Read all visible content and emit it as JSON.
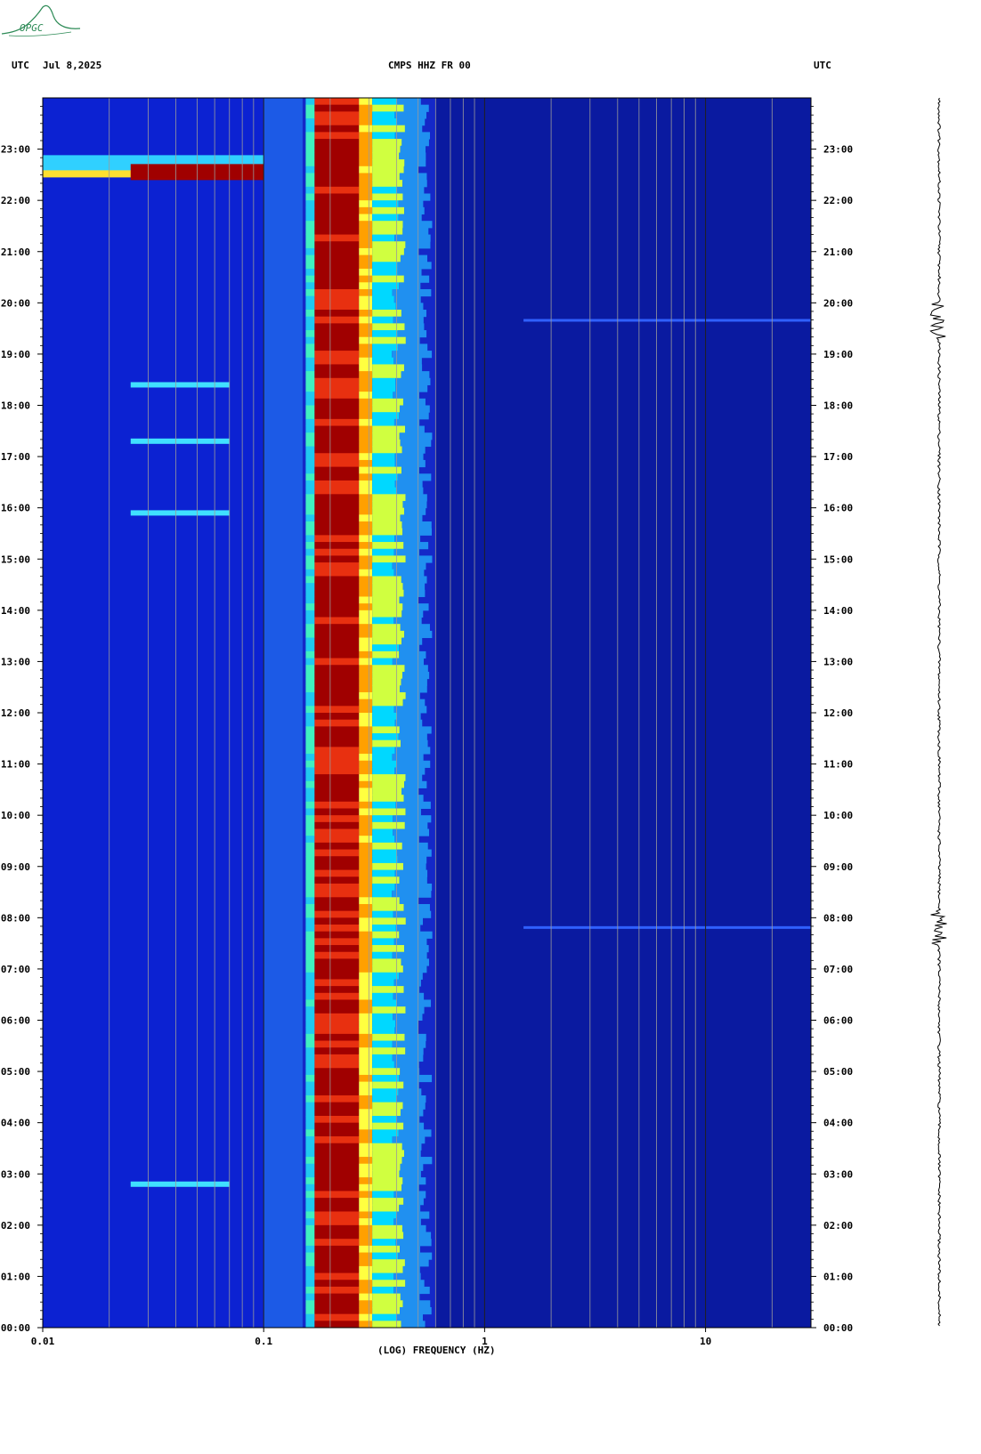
{
  "header": {
    "left_utc": "UTC",
    "date": "Jul 8,2025",
    "station": "CMPS HHZ FR 00",
    "right_utc": "UTC"
  },
  "logo_text": "OPGC",
  "colors": {
    "low": "#0a1aa0",
    "mid": "#00d8ff",
    "high": "#ffff40",
    "peak": "#a00000",
    "grid": "#9a9a9a",
    "trace": "#000000",
    "logo": "#2e8b57"
  },
  "chart_data": {
    "type": "heatmap",
    "title": "CMPS HHZ FR 00",
    "xlabel": "(LOG) FREQUENCY (HZ)",
    "ylabel": "",
    "x_scale": "log",
    "xlim": [
      0.01,
      30
    ],
    "x_ticks": [
      "0.01",
      "0.1",
      "1",
      "10"
    ],
    "ylim_hours": [
      0,
      24
    ],
    "y_ticks": [
      "00:00",
      "01:00",
      "02:00",
      "03:00",
      "04:00",
      "05:00",
      "06:00",
      "07:00",
      "08:00",
      "09:00",
      "10:00",
      "11:00",
      "12:00",
      "13:00",
      "14:00",
      "15:00",
      "16:00",
      "17:00",
      "18:00",
      "19:00",
      "20:00",
      "21:00",
      "22:00",
      "23:00"
    ],
    "microseism_band_hz": [
      0.17,
      0.27
    ],
    "microseism_peak_hz": 0.22,
    "long_period_event_hour": 22.5,
    "secondary_lines_hour": [
      18.4,
      17.3,
      15.9,
      2.8
    ],
    "events_hour": [
      19.65,
      7.8
    ],
    "grid": true
  }
}
